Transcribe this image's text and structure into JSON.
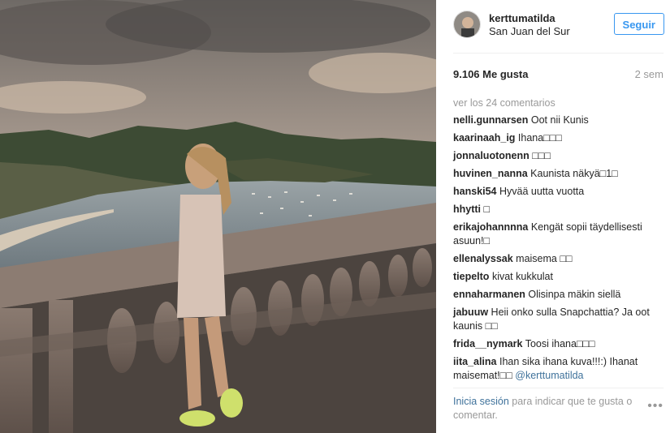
{
  "post": {
    "username": "kerttumatilda",
    "location": "San Juan del Sur",
    "follow_label": "Seguir",
    "likes": "9.106 Me gusta",
    "time": "2 sem",
    "view_comments": "ver los 24 comentarios",
    "comments": [
      {
        "user": "nelli.gunnarsen",
        "text": "Oot nii Kunis"
      },
      {
        "user": "kaarinaah_ig",
        "text": "Ihana□□□"
      },
      {
        "user": "jonnaluotonenn",
        "text": "□□□"
      },
      {
        "user": "huvinen_nanna",
        "text": "Kaunista näkyä□1□"
      },
      {
        "user": "hanski54",
        "text": "Hyvää uutta vuotta"
      },
      {
        "user": "hhytti",
        "text": "□"
      },
      {
        "user": "erikajohannnna",
        "text": "Kengät sopii täydellisesti asuun!□"
      },
      {
        "user": "ellenalyssak",
        "text": "maisema □□"
      },
      {
        "user": "tiepelto",
        "text": "kivat kukkulat"
      },
      {
        "user": "ennaharmanen",
        "text": "Olisinpa mäkin siellä"
      },
      {
        "user": "jabuuw",
        "text": "Heii onko sulla Snapchattia? Ja oot kaunis □□"
      },
      {
        "user": "frida__nymark",
        "text": "Toosi ihana□□□"
      },
      {
        "user": "iita_alina",
        "text": "Ihan sika ihana kuva!!!:) Ihanat maisemat!□□",
        "mention": "@kerttumatilda"
      }
    ],
    "footer_link": "Inicia sesión",
    "footer_text": " para indicar que te gusta o comentar.",
    "more_dots": "•••"
  }
}
